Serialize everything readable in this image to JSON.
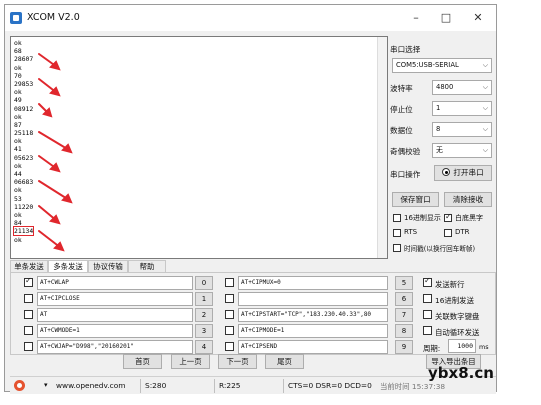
{
  "window": {
    "title": "XCOM V2.0",
    "minimize": "–",
    "maximize": "□",
    "close": "✕"
  },
  "receive": {
    "lines": [
      "ok",
      "68",
      "28607",
      "ok",
      "70",
      "29853",
      "ok",
      "49",
      "08912",
      "ok",
      "87",
      "25118",
      "ok",
      "41",
      "05623",
      "ok",
      "44",
      "06683",
      "ok",
      "53",
      "11220",
      "ok",
      "84",
      "21134",
      "ok"
    ],
    "boxed_line": 23
  },
  "panel": {
    "port_select_label": "串口选择",
    "port_value": "COM5:USB-SERIAL",
    "baud_label": "波特率",
    "baud_value": "4800",
    "stop_label": "停止位",
    "stop_value": "1",
    "data_label": "数据位",
    "data_value": "8",
    "parity_label": "奇偶校验",
    "parity_value": "无",
    "op_label": "串口操作",
    "open_button": "打开串口",
    "save_button": "保存窗口",
    "clear_button": "清除接收",
    "hex_display": "16进制显示",
    "white_black": "白底黑字",
    "rts": "RTS",
    "dtr": "DTR",
    "timestamp": "时间戳(以换行回车断帧)",
    "hex_display_checked": false,
    "white_black_checked": true,
    "rts_checked": false,
    "dtr_checked": false,
    "timestamp_checked": false
  },
  "tabs": [
    "单条发送",
    "多条发送",
    "协议传输",
    "帮助"
  ],
  "active_tab": 1,
  "multi": {
    "left": [
      {
        "checked": true,
        "text": "AT+CWLAP",
        "num": "0"
      },
      {
        "checked": false,
        "text": "AT+CIPCLOSE",
        "num": "1"
      },
      {
        "checked": false,
        "text": "AT",
        "num": "2"
      },
      {
        "checked": false,
        "text": "AT+CWMODE=1",
        "num": "3"
      },
      {
        "checked": false,
        "text": "AT+CWJAP=\"D998\",\"20160201\"",
        "num": "4"
      }
    ],
    "right": [
      {
        "checked": false,
        "text": "AT+CIPMUX=0",
        "num": "5"
      },
      {
        "checked": false,
        "text": "",
        "num": "6"
      },
      {
        "checked": false,
        "text": "AT+CIPSTART=\"TCP\",\"183.230.40.33\",80",
        "num": "7"
      },
      {
        "checked": false,
        "text": "AT+CIPMODE=1",
        "num": "8"
      },
      {
        "checked": false,
        "text": "AT+CIPSEND",
        "num": "9"
      }
    ],
    "send_newline": "发送新行",
    "send_hex": "16进制发送",
    "link_keyboard": "关联数字键盘",
    "auto_loop": "自动循环发送",
    "period_label": "周期:",
    "period_value": "1000",
    "period_unit": "ms",
    "import_export": "导入导出条目",
    "send_newline_checked": true
  },
  "pager": [
    "首页",
    "上一页",
    "下一页",
    "尾页"
  ],
  "status": {
    "url": "www.openedv.com",
    "s": "S:280",
    "r": "R:225",
    "lines": "CTS=0 DSR=0 DCD=0",
    "time": "当前时间 15:37:38"
  },
  "watermark": "ybx8.cn"
}
